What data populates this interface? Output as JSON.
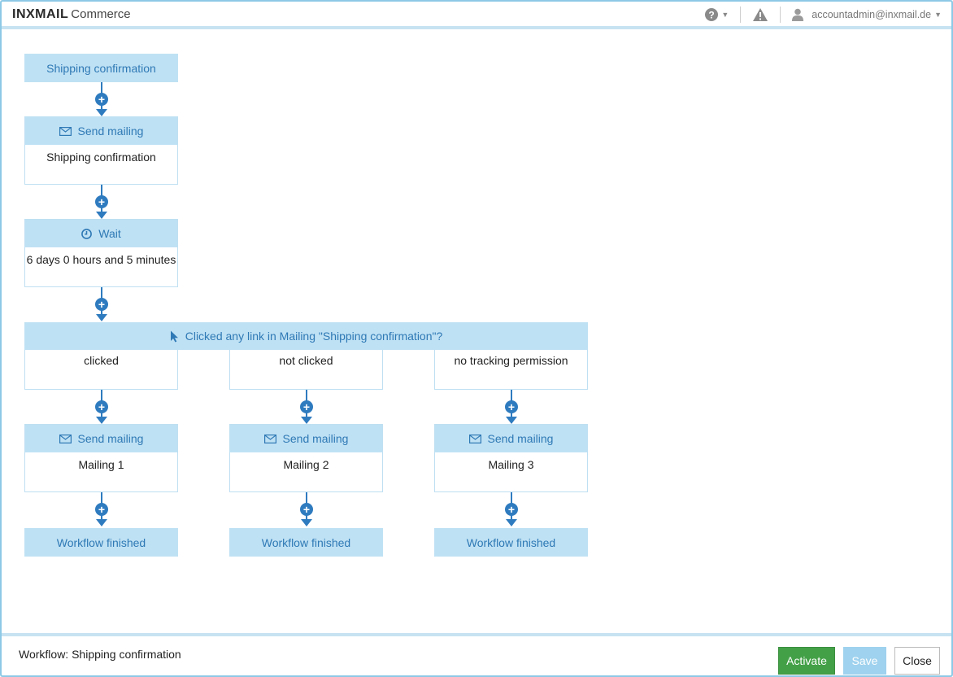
{
  "header": {
    "brand": "INXMAIL",
    "product": "Commerce",
    "user_email": "accountadmin@inxmail.de"
  },
  "workflow": {
    "start": {
      "label": "Shipping confirmation"
    },
    "step1": {
      "type": "Send mailing",
      "value": "Shipping confirmation"
    },
    "step2": {
      "type": "Wait",
      "value": "6 days 0 hours and 5 minutes"
    },
    "branch": {
      "label": "Clicked any link in Mailing \"Shipping confirmation\"?",
      "paths": [
        {
          "condition": "clicked",
          "mailing_label": "Send mailing",
          "mailing": "Mailing 1",
          "end": "Workflow finished"
        },
        {
          "condition": "not clicked",
          "mailing_label": "Send mailing",
          "mailing": "Mailing 2",
          "end": "Workflow finished"
        },
        {
          "condition": "no tracking permission",
          "mailing_label": "Send mailing",
          "mailing": "Mailing 3",
          "end": "Workflow finished"
        }
      ]
    }
  },
  "footer": {
    "title": "Workflow: Shipping confirmation",
    "activate_label": "Activate",
    "save_label": "Save",
    "close_label": "Close"
  },
  "icons": {
    "help": "question-circle-icon",
    "warning": "warning-triangle-icon",
    "user": "user-icon",
    "mail": "envelope-icon",
    "clock": "clock-icon",
    "pointer": "cursor-icon",
    "add": "plus-circle-icon"
  },
  "colors": {
    "node_header_bg": "#bfe1f4",
    "node_header_text": "#2e79b5",
    "connector": "#2f7bbf",
    "activate": "#43a047",
    "save": "#9fd2ee"
  }
}
